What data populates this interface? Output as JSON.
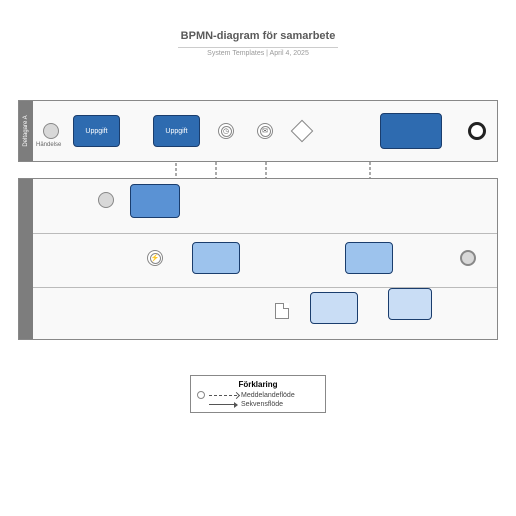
{
  "header": {
    "title": "BPMN-diagram för samarbete",
    "subtitle": "System Templates  |  April 4, 2025"
  },
  "pool_a": {
    "label": "Deltagare A",
    "start_label": "Händelse",
    "tasks": {
      "t1": "Uppgift",
      "t2": "Uppgift"
    }
  },
  "pool_b": {
    "label": ""
  },
  "legend": {
    "title": "Förklaring",
    "message_flow": "Meddelandeflöde",
    "sequence_flow": "Sekvensflöde"
  }
}
